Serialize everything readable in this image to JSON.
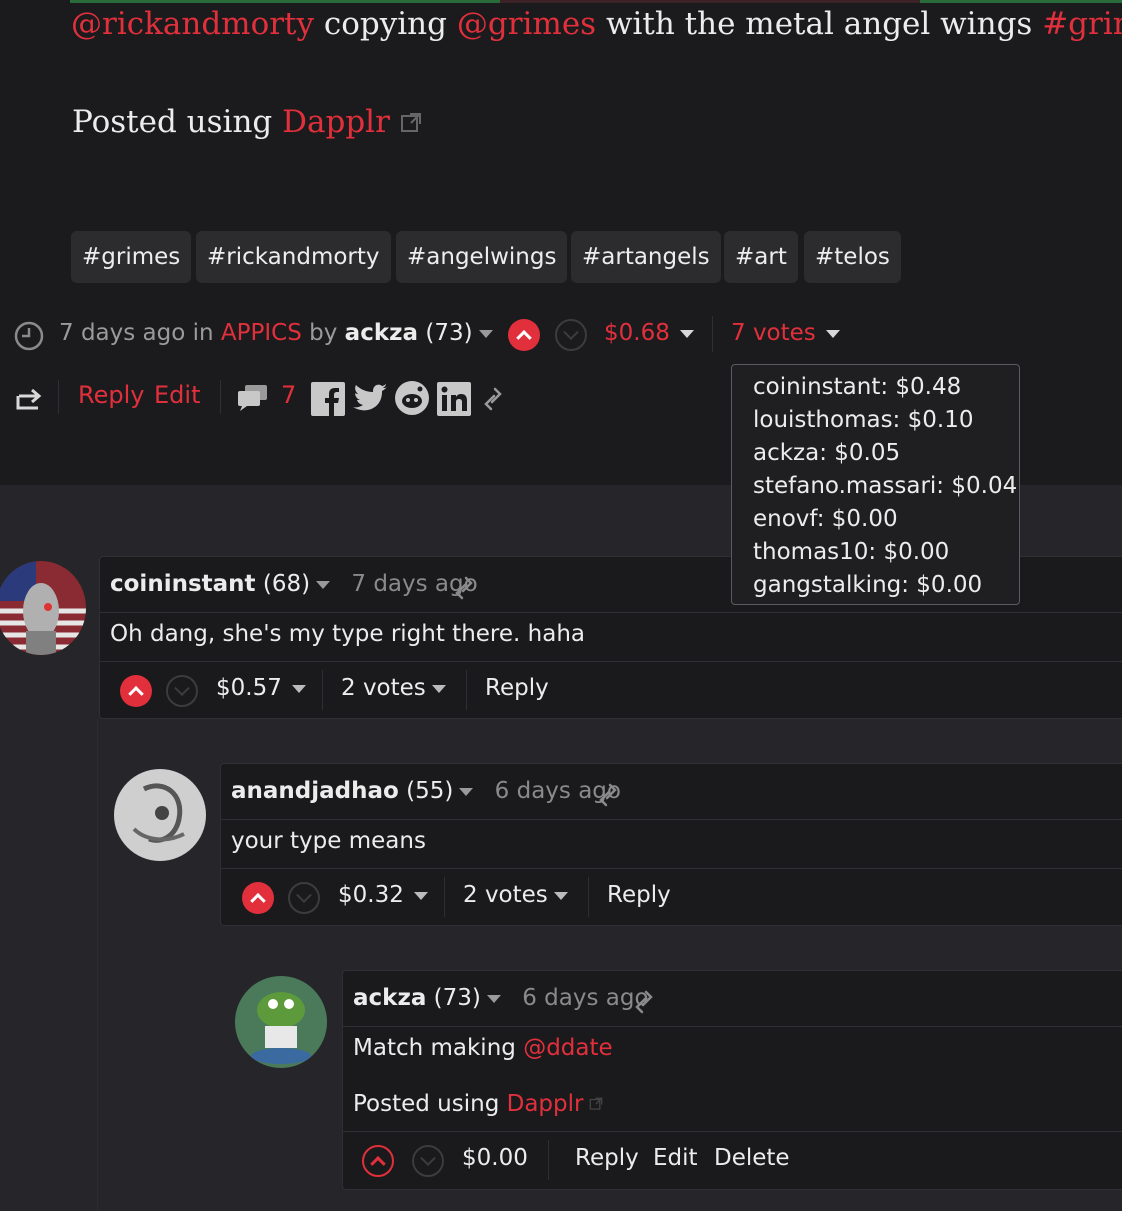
{
  "post": {
    "line1": [
      {
        "text": "@rickandmorty",
        "accent": true
      },
      {
        "text": " copying ",
        "accent": false
      },
      {
        "text": "@grimes",
        "accent": true
      },
      {
        "text": " with the metal angel wings ",
        "accent": false
      },
      {
        "text": "#grimes",
        "accent": true
      }
    ],
    "posted_using_prefix": "Posted using ",
    "posted_using_app": "Dapplr"
  },
  "tags": [
    "#grimes",
    "#rickandmorty",
    "#angelwings",
    "#artangels",
    "#art",
    "#telos"
  ],
  "meta": {
    "time": "7 days ago in ",
    "community": "APPICS",
    "by": " by ",
    "author": "ackza",
    "reputation": "(73)",
    "payout": "0.68",
    "currency": "$",
    "votes": "7 votes"
  },
  "actions": {
    "reply": "Reply",
    "edit": "Edit",
    "comment_count": "7"
  },
  "voters_tooltip": [
    "coininstant: $0.48",
    "louisthomas: $0.10",
    "ackza: $0.05",
    "stefano.massari: $0.04",
    "enovf: $0.00",
    "thomas10: $0.00",
    "gangstalking: $0.00"
  ],
  "comments": [
    {
      "author": "coininstant",
      "reputation": "(68)",
      "time": "7 days ago",
      "body": "Oh dang, she's my type right there. haha",
      "payout": "0.57",
      "votes": "2 votes",
      "reply": "Reply"
    },
    {
      "author": "anandjadhao",
      "reputation": "(55)",
      "time": "6 days ago",
      "body": "your type means",
      "payout": "0.32",
      "votes": "2 votes",
      "reply": "Reply"
    },
    {
      "author": "ackza",
      "reputation": "(73)",
      "time": "6 days ago",
      "body_prefix": "Match making ",
      "body_mention": "@ddate",
      "posted_prefix": "Posted using ",
      "posted_app": "Dapplr",
      "payout": "0.00",
      "reply": "Reply",
      "edit": "Edit",
      "delete": "Delete"
    }
  ],
  "colors": {
    "accent": "#e1303c",
    "background": "#1b1b1d"
  }
}
